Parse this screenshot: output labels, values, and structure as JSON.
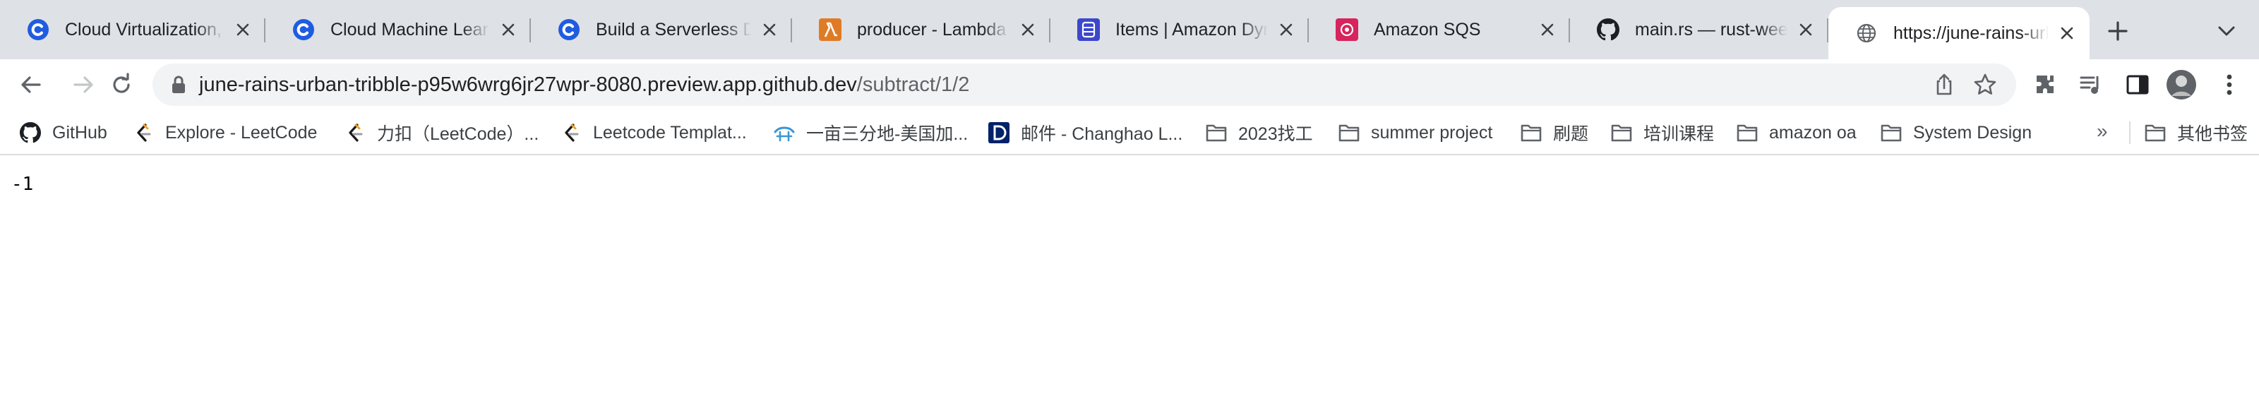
{
  "tabs": [
    {
      "title": "Cloud Virtualization, C",
      "icon": "coursera-icon"
    },
    {
      "title": "Cloud Machine Learnin",
      "icon": "coursera-icon"
    },
    {
      "title": "Build a Serverless Dat",
      "icon": "coursera-icon"
    },
    {
      "title": "producer - Lambda",
      "icon": "aws-lambda-icon"
    },
    {
      "title": "Items | Amazon Dynam",
      "icon": "aws-dynamodb-icon"
    },
    {
      "title": "Amazon SQS",
      "icon": "aws-sqs-icon"
    },
    {
      "title": "main.rs — rust-weekly",
      "icon": "github-icon"
    },
    {
      "title": "https://june-rains-urb",
      "icon": "globe-icon",
      "active": true
    }
  ],
  "omnibox": {
    "host": "june-rains-urban-tribble-p95w6wrg6jr27wpr-8080.preview.app.github.dev",
    "path": "/subtract/1/2"
  },
  "bookmarks": [
    {
      "label": "GitHub",
      "icon": "github-icon"
    },
    {
      "label": "Explore - LeetCode",
      "icon": "leetcode-icon"
    },
    {
      "label": "力扣（LeetCode）...",
      "icon": "leetcode-icon"
    },
    {
      "label": "Leetcode Templat...",
      "icon": "leetcode-icon"
    },
    {
      "label": "一亩三分地-美国加...",
      "icon": "1point3acres-icon"
    },
    {
      "label": "邮件 - Changhao L...",
      "icon": "duke-icon"
    },
    {
      "label": "2023找工",
      "icon": "folder-icon"
    },
    {
      "label": "summer project",
      "icon": "folder-icon"
    },
    {
      "label": "刷题",
      "icon": "folder-icon"
    },
    {
      "label": "培训课程",
      "icon": "folder-icon"
    },
    {
      "label": "amazon oa",
      "icon": "folder-icon"
    },
    {
      "label": "System Design",
      "icon": "folder-icon"
    }
  ],
  "bookmarks_overflow": "»",
  "other_bookmarks": {
    "label": "其他书签",
    "icon": "folder-icon"
  },
  "page": {
    "body_text": "-1"
  },
  "colors": {
    "tabstrip_bg": "#dee1e6",
    "coursera_blue": "#1f5ce0",
    "lambda_orange": "#e07b25",
    "dynamodb_blue": "#3b48cc",
    "sqs_pink": "#d6245c"
  }
}
